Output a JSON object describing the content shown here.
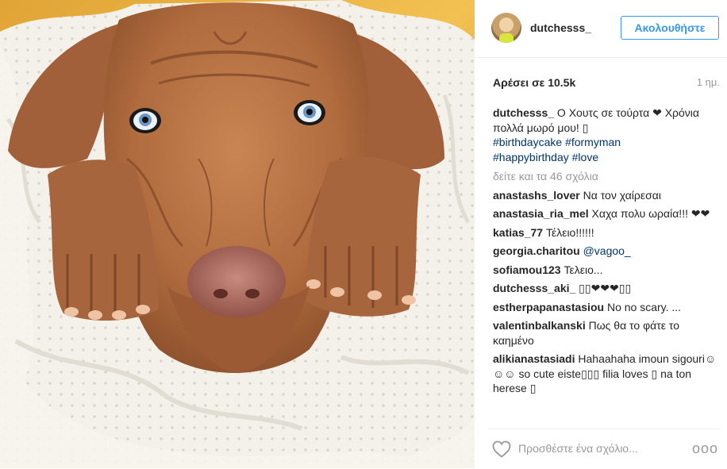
{
  "post": {
    "username": "dutchesss_",
    "follow_label": "Ακολουθήστε",
    "likes": "Αρέσει σε 10.5k",
    "time": "1 ημ.",
    "caption": {
      "user": "dutchesss_",
      "text": " Ο Χουτς σε τούρτα ❤ Χρόνια πολλά μωρό μου! ",
      "tags": [
        "#birthdaycake",
        "#formyman",
        "#happybirthday",
        "#love"
      ]
    },
    "view_all_label": "δείτε και τα 46 σχόλια",
    "comments": [
      {
        "user": "anastashs_lover",
        "text": " Να τον χαίρεσαι"
      },
      {
        "user": "anastasia_ria_mel",
        "text": " Χαχα πολυ ωραία!!! ❤❤"
      },
      {
        "user": "katias_77",
        "text": " Τέλειο!!!!!!"
      },
      {
        "user": "georgia.charitou",
        "text": " ",
        "mention": "@vagoo_"
      },
      {
        "user": "sofiamou123",
        "text": " Τελειο..."
      },
      {
        "user": "dutchesss_aki_",
        "text": " ▯▯❤❤❤▯▯"
      },
      {
        "user": "estherpapanastasiou",
        "text": " No no scary. ..."
      },
      {
        "user": "valentinbalkanski",
        "text": " Πως θα το φάτε το καημένο"
      },
      {
        "user": "alikianastasiadi",
        "text": " Hahaahaha imoun sigouri☺☺☺ so cute eiste▯▯▯ filia loves ▯ na ton herese ▯"
      }
    ],
    "add_comment_placeholder": "Προσθέστε ένα σχόλιο...",
    "more_options": "ooo"
  },
  "icons": {
    "like": "heart-outline-icon",
    "more": "more-options-icon"
  },
  "colors": {
    "link": "#003569",
    "follow": "#3897f0",
    "muted": "#999999"
  }
}
